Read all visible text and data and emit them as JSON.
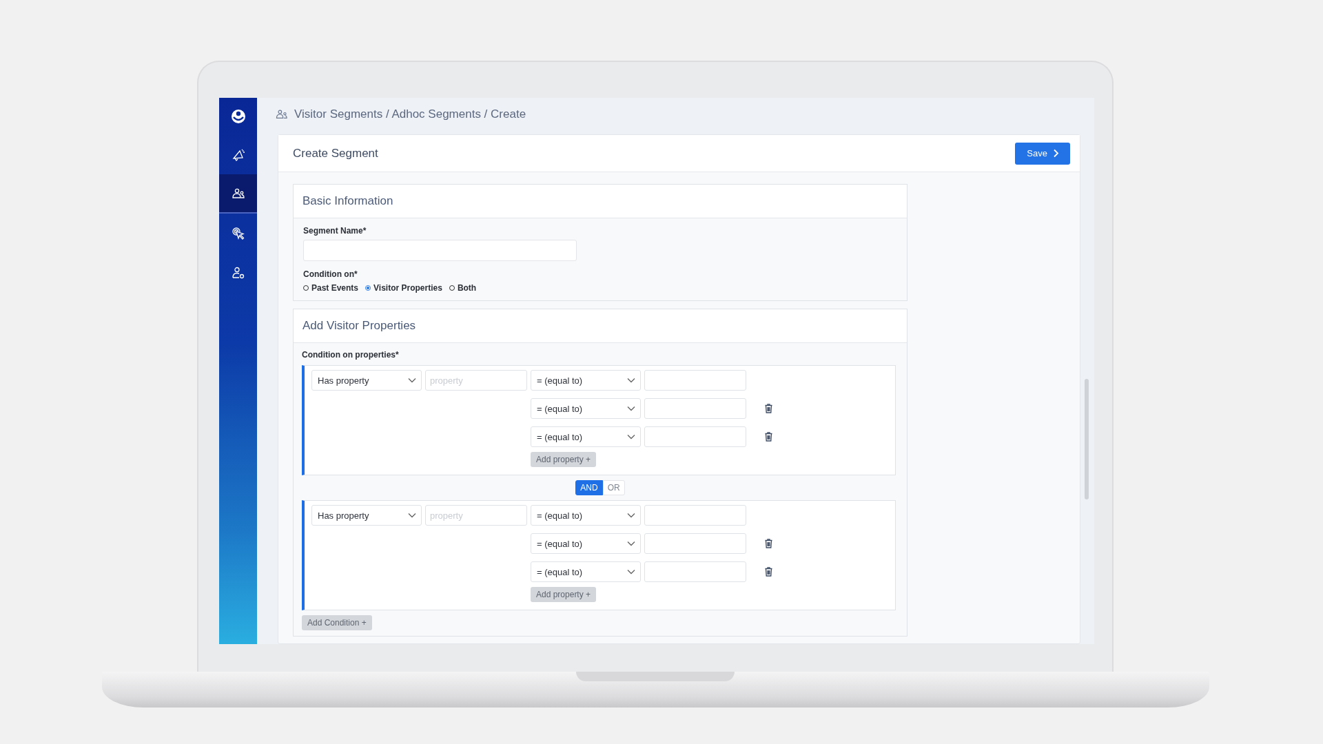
{
  "sidebar": {
    "items": [
      {
        "kind": "megaphone",
        "selected": false
      },
      {
        "kind": "people",
        "selected": true
      },
      {
        "kind": "cursor",
        "selected": false
      },
      {
        "kind": "user-settings",
        "selected": false
      }
    ]
  },
  "breadcrumb": "Visitor Segments / Adhoc Segments / Create",
  "card": {
    "title": "Create Segment",
    "save_button": "Save"
  },
  "basic_information": {
    "title": "Basic Information",
    "segment_name": {
      "label": "Segment Name*"
    },
    "condition_on": {
      "label": "Condition on*",
      "options": [
        {
          "label": "Past Events",
          "selected": false
        },
        {
          "label": "Visitor Properties",
          "selected": true
        },
        {
          "label": "Both",
          "selected": false
        }
      ]
    }
  },
  "visitor_properties": {
    "title": "Add Visitor Properties",
    "label": "Condition on properties*",
    "groups": [
      {
        "type_select": "Has property",
        "property_placeholder": "property",
        "rows": [
          {
            "operator": "= (equal to)",
            "deletable": false
          },
          {
            "operator": "= (equal to)",
            "deletable": true
          },
          {
            "operator": "= (equal to)",
            "deletable": true
          }
        ],
        "add_property": "Add property +"
      },
      {
        "type_select": "Has property",
        "property_placeholder": "property",
        "rows": [
          {
            "operator": "= (equal to)",
            "deletable": false
          },
          {
            "operator": "= (equal to)",
            "deletable": true
          },
          {
            "operator": "= (equal to)",
            "deletable": true
          }
        ],
        "add_property": "Add property +"
      }
    ],
    "connector": {
      "options": [
        {
          "label": "AND",
          "selected": true
        },
        {
          "label": "OR",
          "selected": false
        }
      ]
    },
    "add_condition": "Add Condition +"
  }
}
